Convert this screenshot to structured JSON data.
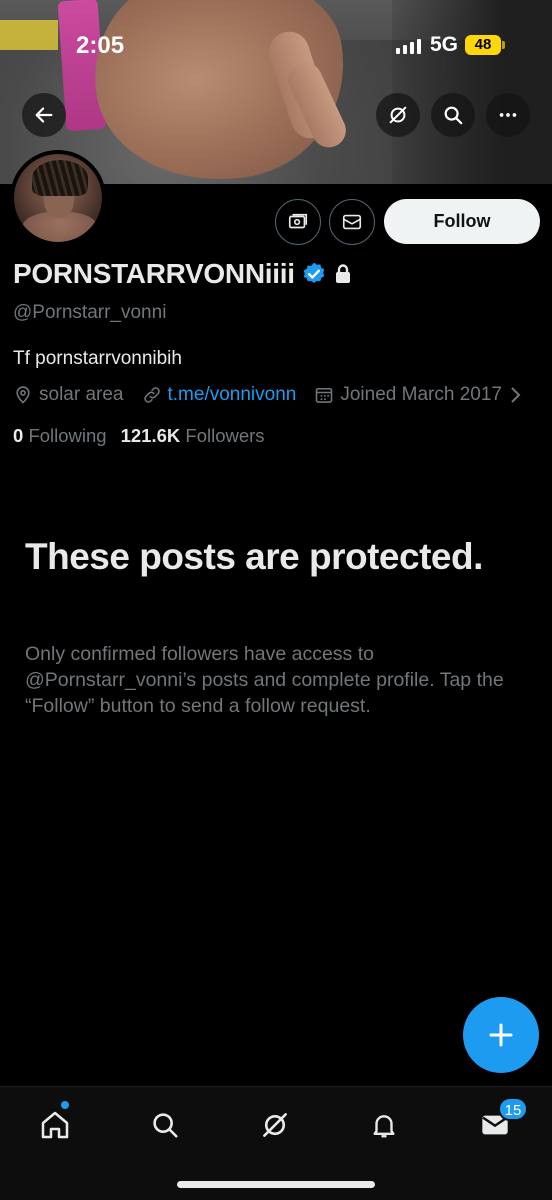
{
  "status_bar": {
    "time": "2:05",
    "network": "5G",
    "battery": "48"
  },
  "nav": {
    "back_icon": "arrow-left-icon",
    "grok_icon": "grok-icon",
    "search_icon": "search-icon",
    "more_icon": "more-horizontal-icon"
  },
  "profile": {
    "display_name": "PORNSTARRVONNiiii",
    "handle": "@Pornstarr_vonni",
    "bio": "Tf pornstarrvonnibih",
    "location": "solar area",
    "link": "t.me/vonnivonn",
    "joined": "Joined March 2017",
    "following_count": "0",
    "following_label": "Following",
    "followers_count": "121.6K",
    "followers_label": "Followers",
    "verified": true,
    "protected": true
  },
  "actions": {
    "follow_label": "Follow",
    "subscribe_icon": "money-icon",
    "message_icon": "mail-icon"
  },
  "protected_notice": {
    "title": "These posts are protected.",
    "description": "Only confirmed followers have access to @Pornstarr_vonni’s posts and complete profile. Tap the “Follow” button to send a follow request."
  },
  "tabbar": {
    "items": [
      "home-icon",
      "search-icon",
      "grok-icon",
      "notifications-icon",
      "messages-icon"
    ],
    "messages_badge": "15"
  },
  "colors": {
    "accent": "#1d9bf0",
    "background": "#000000",
    "text_primary": "#e7e9ea",
    "text_secondary": "#71767b"
  }
}
